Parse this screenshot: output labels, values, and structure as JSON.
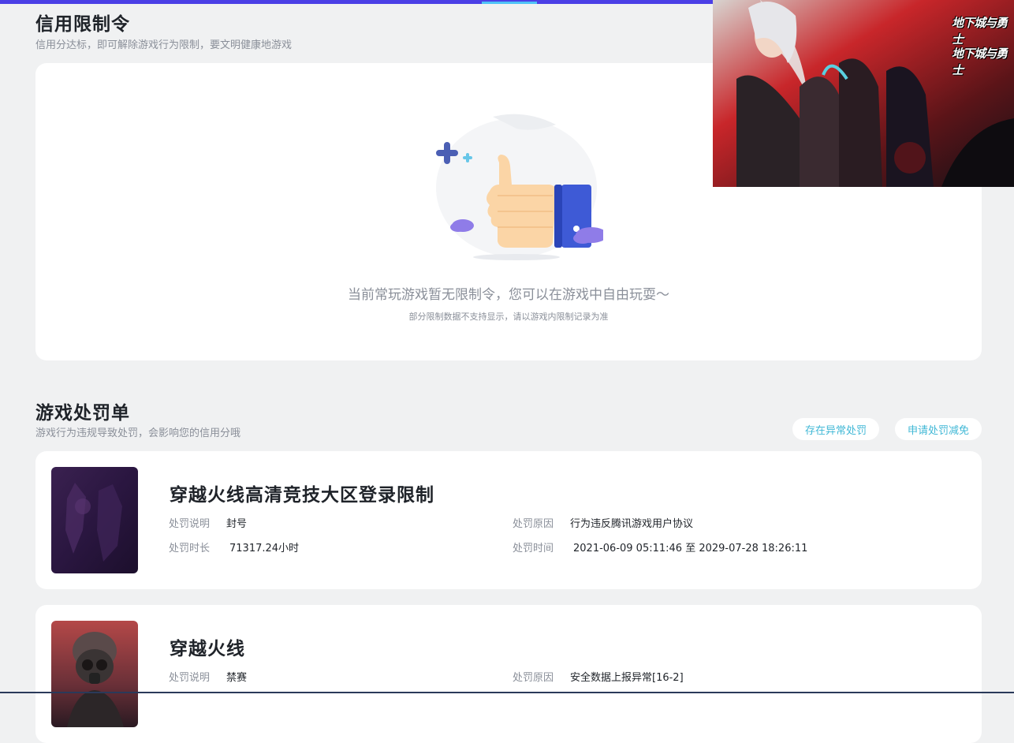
{
  "colors": {
    "accent_bar": "#4b3fe6",
    "link": "#41b8d6",
    "muted": "#8a8f99",
    "heading": "#1f2329"
  },
  "credit_restriction": {
    "title": "信用限制令",
    "subtitle": "信用分达标，即可解除游戏行为限制，要文明健康地游戏",
    "empty_message": "当前常玩游戏暂无限制令，您可以在游戏中自由玩耍～",
    "empty_note": "部分限制数据不支持显示，请以游戏内限制记录为准",
    "illustration_icon": "thumbs-up-icon"
  },
  "penalties": {
    "title": "游戏处罚单",
    "subtitle": "游戏行为违规导致处罚，会影响您的信用分哦",
    "abnormal_button": "存在异常处罚",
    "appeal_button": "申请处罚减免",
    "labels": {
      "desc": "处罚说明",
      "reason": "处罚原因",
      "duration": "处罚时长",
      "time": "处罚时间"
    },
    "items": [
      {
        "game_title": "穿越火线高清竞技大区登录限制",
        "desc": "封号",
        "reason": "行为违反腾讯游戏用户协议",
        "duration": "71317.24小时",
        "time": "2021-06-09 05:11:46 至 2029-07-28 18:26:11"
      },
      {
        "game_title": "穿越火线",
        "desc": "禁赛",
        "reason": "安全数据上报异常[16-2]"
      }
    ]
  },
  "ad_banner": {
    "logo_text_1": "地下城与勇士",
    "logo_text_2": "地下城与勇士"
  }
}
